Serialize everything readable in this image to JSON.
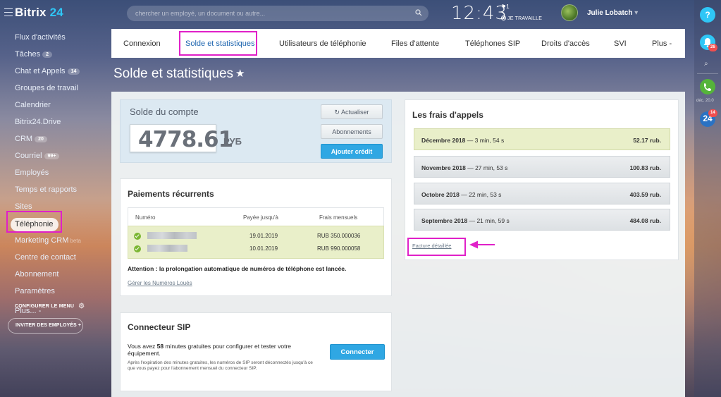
{
  "brand": {
    "name_part1": "Bitrix",
    "name_part2": "24"
  },
  "search": {
    "placeholder": "chercher un employé, un document ou autre..."
  },
  "clock": {
    "time": "12:43",
    "flag_count": "1",
    "work_status": "JE TRAVAILLE"
  },
  "user": {
    "name": "Julie Lobatch"
  },
  "sidebar": {
    "items": [
      {
        "label": "Flux d'activités"
      },
      {
        "label": "Tâches",
        "count": "2"
      },
      {
        "label": "Chat et Appels",
        "count": "14"
      },
      {
        "label": "Groupes de travail"
      },
      {
        "label": "Calendrier"
      },
      {
        "label": "Bitrix24.Drive"
      },
      {
        "label": "CRM",
        "count": "20"
      },
      {
        "label": "Courriel",
        "count": "99+"
      },
      {
        "label": "Employés"
      },
      {
        "label": "Temps et rapports"
      },
      {
        "label": "Sites"
      },
      {
        "label": "Téléphonie"
      },
      {
        "label": "Marketing CRM",
        "beta": "beta"
      },
      {
        "label": "Centre de contact"
      },
      {
        "label": "Abonnement"
      },
      {
        "label": "Paramètres"
      },
      {
        "label": "Plus... -"
      }
    ],
    "configure_menu": "CONFIGURER LE MENU",
    "invite_employees": "INVITER DES EMPLOYÉS  +"
  },
  "tabs": [
    {
      "label": "Connexion"
    },
    {
      "label": "Solde et statistiques"
    },
    {
      "label": "Utilisateurs de téléphonie"
    },
    {
      "label": "Files d'attente"
    },
    {
      "label": "Téléphones SIP"
    },
    {
      "label": "Droits d'accès"
    },
    {
      "label": "SVI"
    },
    {
      "label": "Plus -"
    }
  ],
  "page_title": "Solde et statistiques",
  "balance": {
    "title": "Solde du compte",
    "amount": "4778.61",
    "currency": "РУБ",
    "refresh_label": "Actualiser",
    "subscriptions_label": "Abonnements",
    "add_credit_label": "Ajouter crédit"
  },
  "payments": {
    "title": "Paiements récurrents",
    "headers": [
      "Numéro",
      "Payée jusqu'à",
      "Frais mensuels"
    ],
    "rows": [
      {
        "paid_until": "19.01.2019",
        "fee": "RUB 350.000036"
      },
      {
        "paid_until": "10.01.2019",
        "fee": "RUB 990.000058"
      }
    ],
    "attention": "Attention : la prolongation automatique de numéros de téléphone est lancée.",
    "manage_link": "Gérer les Numéros Loués"
  },
  "sip": {
    "title": "Connecteur SIP",
    "text_before": "Vous avez ",
    "minutes": "58",
    "text_after": " minutes gratuites pour configurer et tester votre équipement.",
    "note": "Après l'expiration des minutes gratuites, les numéros de SIP seront déconnectés jusqu'à ce que vous payez pour l'abonnement mensuel du connecteur SIP.",
    "connect_label": "Connecter"
  },
  "call_fees": {
    "title": "Les frais d'appels",
    "rows": [
      {
        "month": "Décembre 2018",
        "duration": "— 3 min, 54 s",
        "amount": "52.17 rub."
      },
      {
        "month": "Novembre 2018",
        "duration": "— 27 min, 53 s",
        "amount": "100.83 rub."
      },
      {
        "month": "Octobre 2018",
        "duration": "— 22 min, 53 s",
        "amount": "403.59 rub."
      },
      {
        "month": "Septembre 2018",
        "duration": "— 21 min, 59 s",
        "amount": "484.08 rub."
      }
    ],
    "detailed_invoice": "Facture détaillée"
  },
  "rightbar": {
    "help": "?",
    "notif_count": "26",
    "date": "déc. 20.0",
    "chat_count": "14",
    "b24_label": "24"
  },
  "colors": {
    "accent": "#2fc6f6",
    "highlight": "#e020c8",
    "primary_button": "#2fa7e3",
    "active_tab": "#2067b0"
  }
}
